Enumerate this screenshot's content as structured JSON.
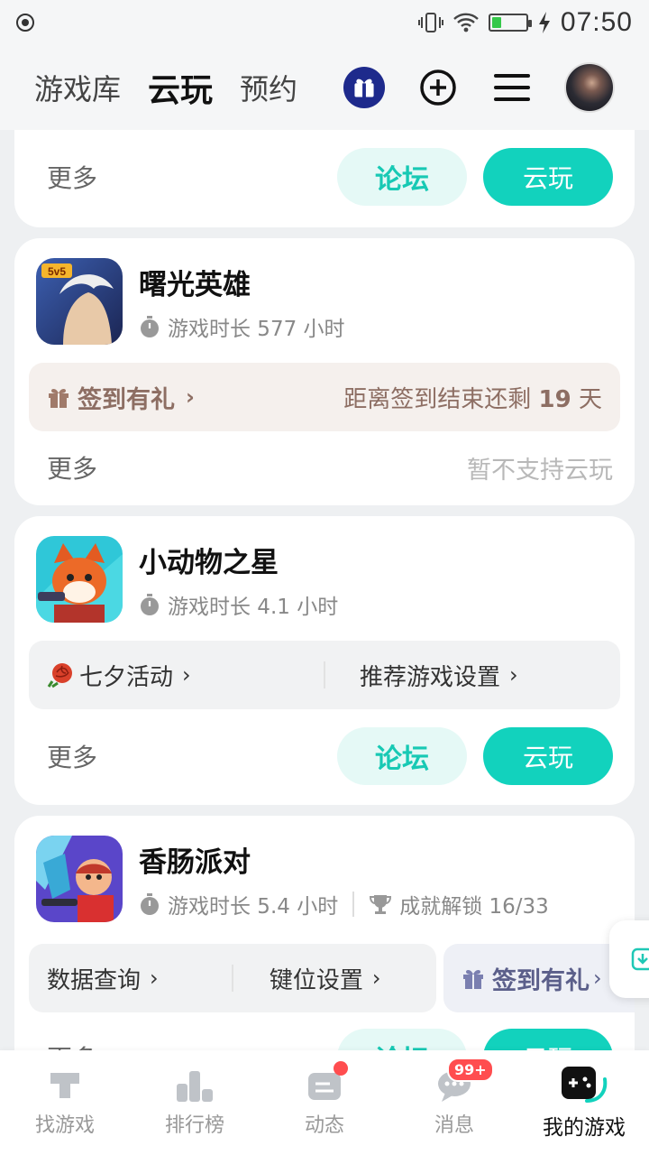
{
  "status_bar": {
    "time": "07:50"
  },
  "top_nav": {
    "tabs": [
      "游戏库",
      "云玩",
      "预约"
    ],
    "active_tab": "云玩"
  },
  "partial_card": {
    "more": "更多",
    "forum": "论坛",
    "cloud_play": "云玩"
  },
  "games": [
    {
      "name": "曙光英雄",
      "play_time": "游戏时长 577 小时",
      "checkin_label": "签到有礼",
      "checkin_remaining_prefix": "距离签到结束还剩 ",
      "checkin_remaining_days": "19",
      "checkin_remaining_suffix": " 天",
      "more": "更多",
      "unsupported": "暂不支持云玩"
    },
    {
      "name": "小动物之星",
      "play_time": "游戏时长 4.1 小时",
      "event_label": "七夕活动",
      "settings_label": "推荐游戏设置",
      "more": "更多",
      "forum": "论坛",
      "cloud_play": "云玩"
    },
    {
      "name": "香肠派对",
      "play_time": "游戏时长 5.4 小时",
      "achievements": "成就解锁 16/33",
      "data_query": "数据查询",
      "key_settings": "键位设置",
      "checkin_label": "签到有礼",
      "more": "更多",
      "forum": "论坛",
      "cloud_play": "云玩"
    }
  ],
  "bottom_nav": {
    "items": [
      "找游戏",
      "排行榜",
      "动态",
      "消息",
      "我的游戏"
    ],
    "message_badge": "99+",
    "active": "我的游戏"
  },
  "colors": {
    "accent": "#12d2bd",
    "checkin_text": "#8d6e63",
    "badge": "#ff4d4f"
  }
}
